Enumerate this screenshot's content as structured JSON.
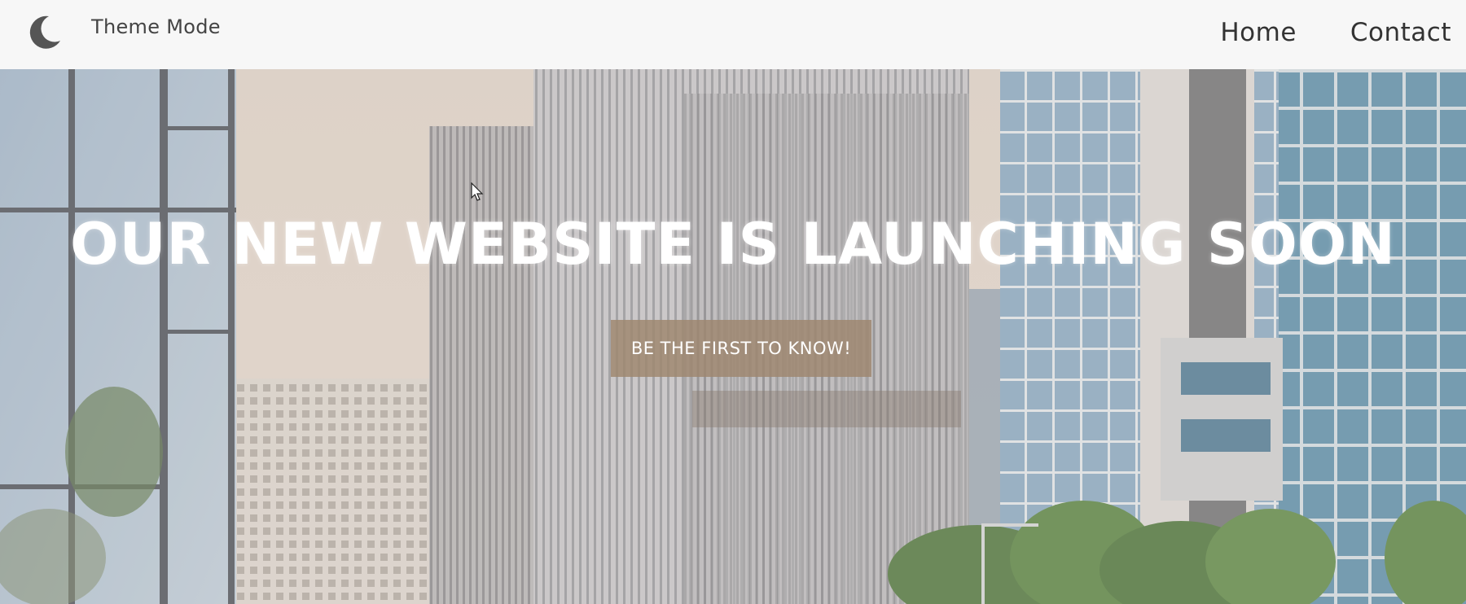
{
  "navbar": {
    "theme_toggle": {
      "label": "Theme Mode",
      "icon": "moon-icon"
    },
    "links": [
      {
        "label": "Home"
      },
      {
        "label": "Contact"
      }
    ]
  },
  "hero": {
    "title": "OUR NEW WEBSITE IS LAUNCHING SOON",
    "cta_label": "BE THE FIRST TO KNOW!",
    "background": "city-skyscrapers-image"
  },
  "colors": {
    "nav_bg": "#f7f7f7",
    "nav_text": "#333333",
    "cta_bg": "#9e866e",
    "title_text": "#ffffff"
  }
}
